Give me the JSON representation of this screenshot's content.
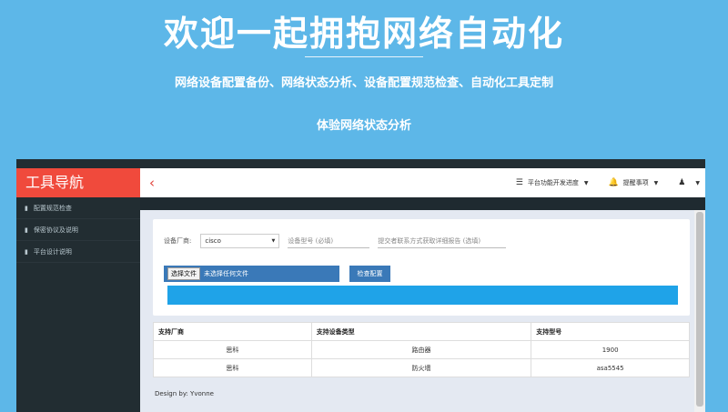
{
  "hero": {
    "title": "欢迎一起拥抱网络自动化",
    "subtitle": "网络设备配置备份、网络状态分析、设备配置规范检查、自动化工具定制",
    "link": "体验网络状态分析"
  },
  "app": {
    "brand": "工具导航",
    "back_icon": "chevron-left-icon",
    "nav": [
      {
        "label": "平台功能开发进度",
        "icon": "list-icon"
      },
      {
        "label": "提醒事项",
        "icon": "bell-icon"
      },
      {
        "label": "",
        "icon": "user-icon"
      }
    ],
    "sidebar": [
      {
        "label": "配置规范检查",
        "icon": "file-icon"
      },
      {
        "label": "保密协议及说明",
        "icon": "file-icon"
      },
      {
        "label": "平台设计说明",
        "icon": "file-icon"
      }
    ]
  },
  "form": {
    "vendor_label": "设备厂商:",
    "vendor_value": "cisco",
    "model_placeholder": "设备型号 (必填)",
    "email_placeholder": "提交者联系方式获取详细报告 (选填)",
    "file_button": "选择文件",
    "file_status": "未选择任何文件",
    "check_button": "检查配置",
    "progress_color": "#1fa3e8"
  },
  "table": {
    "headers": [
      "支持厂商",
      "支持设备类型",
      "支持型号"
    ],
    "rows": [
      [
        "思科",
        "路由器",
        "1900"
      ],
      [
        "思科",
        "防火墙",
        "asa5545"
      ]
    ]
  },
  "footer": "Design by: Yvonne",
  "colors": {
    "background": "#5db7e8",
    "brand": "#f04a3c",
    "sidebar": "#222d32",
    "primary_button": "#3a79b8"
  }
}
